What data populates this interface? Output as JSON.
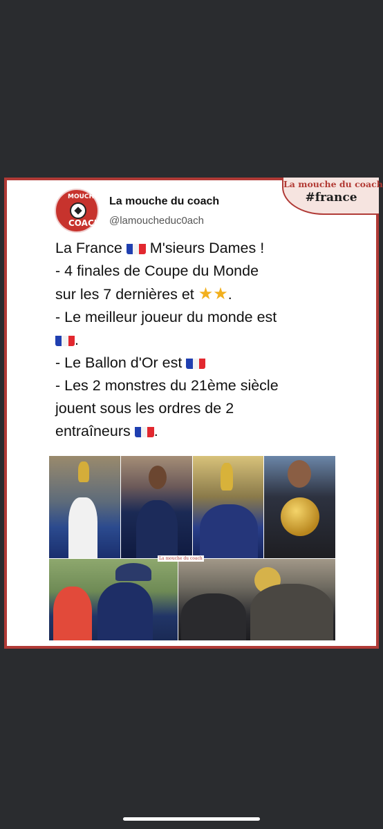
{
  "tag": {
    "brand": "La mouche du coach",
    "hashtag": "#france"
  },
  "logo": {
    "top_text": "MOUCHE",
    "bottom_text": "COACH"
  },
  "account": {
    "name": "La mouche du coach",
    "handle": "@lamoucheduc0ach"
  },
  "tweet": {
    "line1_a": "La France",
    "line1_b": "M'sieurs Dames !",
    "line2": "- 4 finales de Coupe du Monde",
    "line3": "sur les 7 dernières et",
    "line3_end": ".",
    "line4": "- Le meilleur joueur du monde est",
    "line5_end": ".",
    "line6": "- Le Ballon d'Or est",
    "line7": "- Les 2 monstres du 21ème siècle",
    "line8": "jouent sous les ordres de 2",
    "line9": "entraîneurs",
    "line9_end": "."
  },
  "collage": {
    "watermark": "La mouche du coach"
  },
  "colors": {
    "brand_red": "#b03a36",
    "flag_blue": "#1f3fb0",
    "flag_red": "#e2282f",
    "star": "#f2b01e"
  },
  "icons": {
    "flag": "france-flag-icon",
    "star": "star-icon"
  }
}
